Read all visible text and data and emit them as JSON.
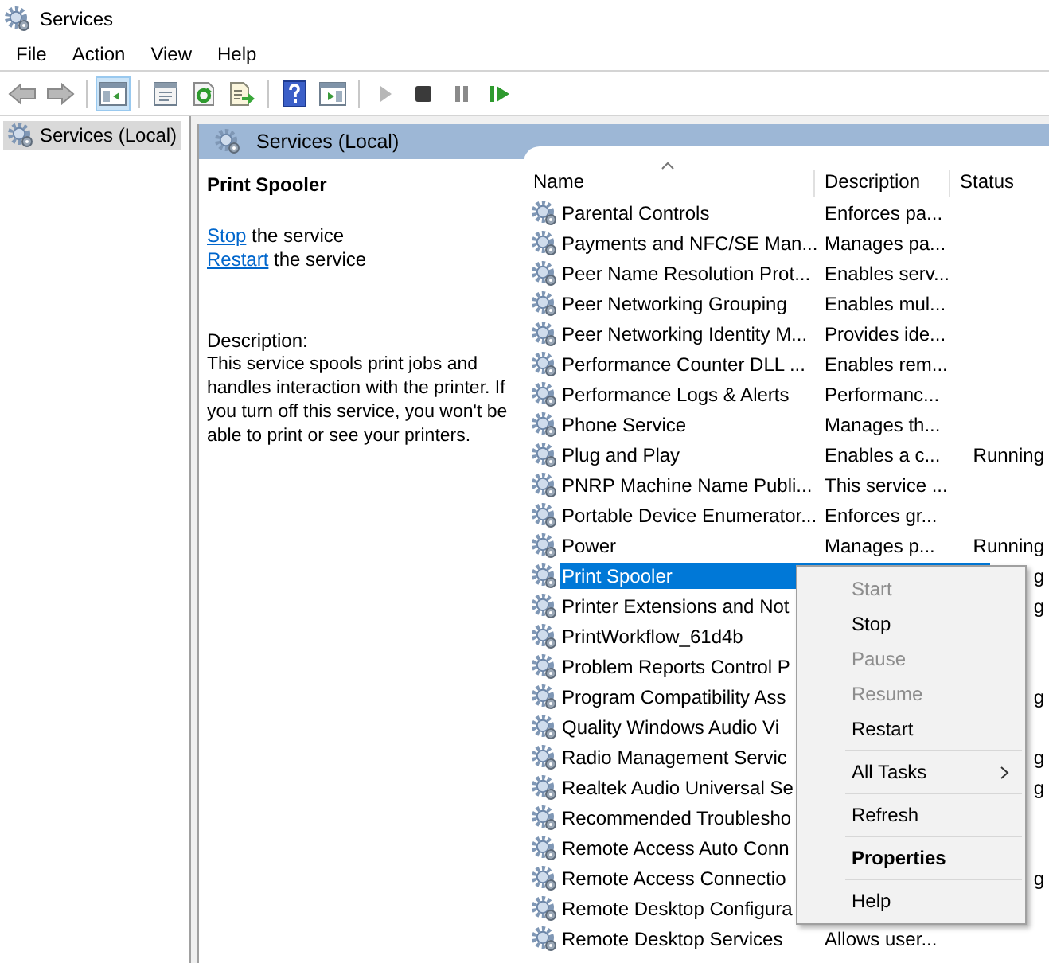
{
  "window": {
    "title": "Services"
  },
  "menu": [
    "File",
    "Action",
    "View",
    "Help"
  ],
  "toolbar": [
    {
      "kind": "back",
      "selected": false,
      "disabled": false
    },
    {
      "kind": "forward",
      "selected": false,
      "disabled": false
    },
    {
      "kind": "separator"
    },
    {
      "kind": "tree",
      "selected": true,
      "disabled": false
    },
    {
      "kind": "separator"
    },
    {
      "kind": "properties",
      "selected": false,
      "disabled": false
    },
    {
      "kind": "refresh",
      "selected": false,
      "disabled": false
    },
    {
      "kind": "export",
      "selected": false,
      "disabled": false
    },
    {
      "kind": "separator"
    },
    {
      "kind": "help",
      "selected": false,
      "disabled": false
    },
    {
      "kind": "pane",
      "selected": false,
      "disabled": false
    },
    {
      "kind": "separator"
    },
    {
      "kind": "start",
      "selected": false,
      "disabled": true
    },
    {
      "kind": "stop",
      "selected": false,
      "disabled": false
    },
    {
      "kind": "pause",
      "selected": false,
      "disabled": false
    },
    {
      "kind": "resume",
      "selected": false,
      "disabled": false
    }
  ],
  "tree": {
    "items": [
      {
        "label": "Services (Local)",
        "selected": true
      }
    ]
  },
  "header": {
    "title": "Services (Local)"
  },
  "details": {
    "title": "Print Spooler",
    "actions": [
      {
        "link": "Stop",
        "text": "the service"
      },
      {
        "link": "Restart",
        "text": "the service"
      }
    ],
    "description_label": "Description:",
    "description": "This service spools print jobs and handles interaction with the printer. If you turn off this service, you won't be able to print or see your printers."
  },
  "table": {
    "columns": [
      "Name",
      "Description",
      "Status"
    ],
    "rows": [
      {
        "name": "Parental Controls",
        "description": "Enforces pa...",
        "selected": false
      },
      {
        "name": "Payments and NFC/SE Man...",
        "description": "Manages pa...",
        "selected": false
      },
      {
        "name": "Peer Name Resolution Prot...",
        "description": "Enables serv...",
        "selected": false
      },
      {
        "name": "Peer Networking Grouping",
        "description": "Enables mul...",
        "selected": false
      },
      {
        "name": "Peer Networking Identity M...",
        "description": "Provides ide...",
        "selected": false
      },
      {
        "name": "Performance Counter DLL ...",
        "description": "Enables rem...",
        "selected": false
      },
      {
        "name": "Performance Logs & Alerts",
        "description": "Performanc...",
        "selected": false
      },
      {
        "name": "Phone Service",
        "description": "Manages th...",
        "selected": false
      },
      {
        "name": "Plug and Play",
        "description": "Enables a c...",
        "status": "Running",
        "selected": false
      },
      {
        "name": "PNRP Machine Name Publi...",
        "description": "This service ...",
        "selected": false
      },
      {
        "name": "Portable Device Enumerator...",
        "description": "Enforces gr...",
        "selected": false
      },
      {
        "name": "Power",
        "description": "Manages p...",
        "status": "Running",
        "selected": false
      },
      {
        "name": "Print Spooler",
        "status": "g",
        "selected": true
      },
      {
        "name": "Printer Extensions and Not",
        "status": "g",
        "selected": false
      },
      {
        "name": "PrintWorkflow_61d4b",
        "selected": false
      },
      {
        "name": "Problem Reports Control P",
        "selected": false
      },
      {
        "name": "Program Compatibility Ass",
        "status": "g",
        "selected": false
      },
      {
        "name": "Quality Windows Audio Vi",
        "selected": false
      },
      {
        "name": "Radio Management Servic",
        "status": "g",
        "selected": false
      },
      {
        "name": "Realtek Audio Universal Se",
        "status": "g",
        "selected": false
      },
      {
        "name": "Recommended Troublesho",
        "selected": false
      },
      {
        "name": "Remote Access Auto Conn",
        "selected": false
      },
      {
        "name": "Remote Access Connectio",
        "status": "g",
        "selected": false
      },
      {
        "name": "Remote Desktop Configura",
        "selected": false
      },
      {
        "name": "Remote Desktop Services",
        "description": "Allows user...",
        "selected": false
      }
    ]
  },
  "context_menu": [
    {
      "kind": "item",
      "label": "Start",
      "disabled": true
    },
    {
      "kind": "item",
      "label": "Stop",
      "disabled": false
    },
    {
      "kind": "item",
      "label": "Pause",
      "disabled": true
    },
    {
      "kind": "item",
      "label": "Resume",
      "disabled": true
    },
    {
      "kind": "item",
      "label": "Restart",
      "disabled": false
    },
    {
      "kind": "separator"
    },
    {
      "kind": "submenu",
      "label": "All Tasks",
      "disabled": false
    },
    {
      "kind": "separator"
    },
    {
      "kind": "item",
      "label": "Refresh",
      "disabled": false
    },
    {
      "kind": "separator"
    },
    {
      "kind": "default",
      "label": "Properties",
      "disabled": false
    },
    {
      "kind": "separator"
    },
    {
      "kind": "item",
      "label": "Help",
      "disabled": false
    }
  ]
}
